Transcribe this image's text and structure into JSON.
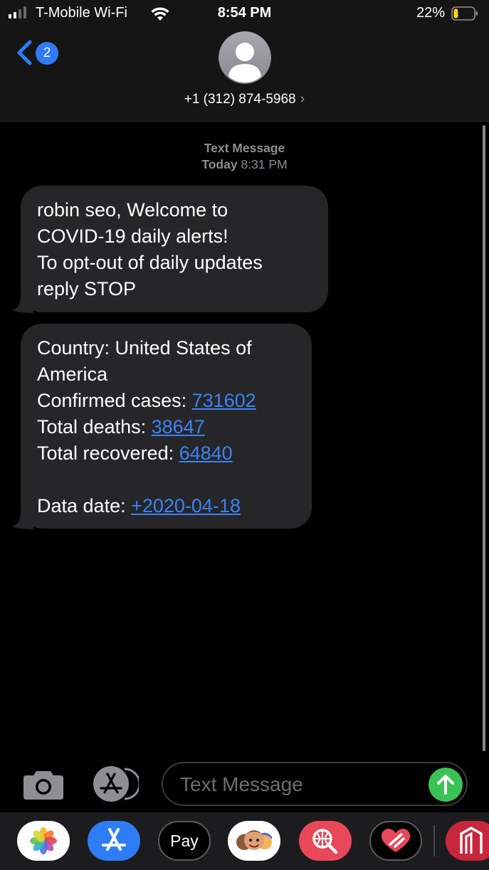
{
  "status_bar": {
    "carrier": "T-Mobile Wi-Fi",
    "time": "8:54 PM",
    "battery_percent": "22%",
    "battery_level": 0.22,
    "signal_icon": "signal-bars-icon",
    "wifi_icon": "wifi-icon",
    "battery_icon": "battery-icon"
  },
  "nav": {
    "back_badge": "2",
    "contact_name": "+1 (312) 874-5968",
    "contact_chevron": "›"
  },
  "thread": {
    "header_label": "Text Message",
    "header_day": "Today",
    "header_time": "8:31 PM",
    "message_1": {
      "lines": [
        "robin seo, Welcome to",
        "COVID-19 daily alerts!",
        "To opt-out of daily updates",
        "reply STOP"
      ]
    },
    "message_2": {
      "country_line_1": "Country: United States of",
      "country_line_2": "America",
      "confirmed_label": "Confirmed cases: ",
      "confirmed_value": "731602",
      "deaths_label": "Total deaths: ",
      "deaths_value": "38647",
      "recovered_label": "Total recovered: ",
      "recovered_value": "64840",
      "date_label": "Data date: ",
      "date_value": "+2020-04-18"
    }
  },
  "compose": {
    "placeholder": "Text Message",
    "send_color": "#3bc255"
  },
  "app_drawer": {
    "apple_pay_label": "Pay",
    "apps": [
      "photos-icon",
      "app-store-icon",
      "apple-pay-icon",
      "memoji-icon",
      "search-globe-icon",
      "heart-icon",
      "building-app-icon"
    ]
  },
  "colors": {
    "accent_blue": "#2f7cf6",
    "link_blue": "#3b82f7",
    "bubble_gray": "#262628"
  }
}
